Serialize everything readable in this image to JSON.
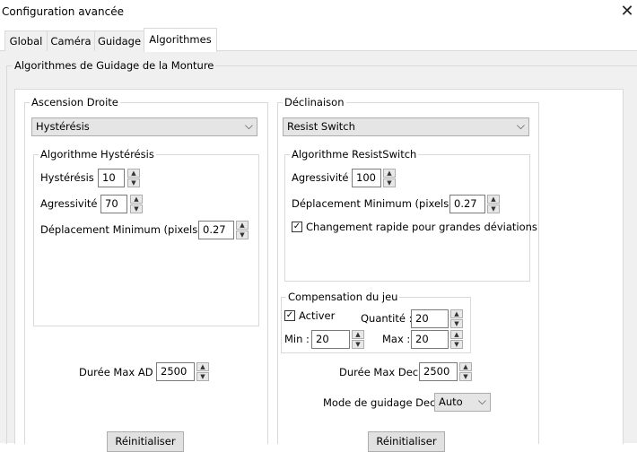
{
  "window": {
    "title": "Configuration avancée"
  },
  "tabs": [
    {
      "label": "Global"
    },
    {
      "label": "Caméra"
    },
    {
      "label": "Guidage"
    },
    {
      "label": "Algorithmes"
    }
  ],
  "section": {
    "title": "Algorithmes de Guidage de la Monture"
  },
  "ra": {
    "title": "Ascension Droite",
    "algorithm_select": "Hystérésis",
    "algo_box_title": "Algorithme Hystérésis",
    "hysteresis_label": "Hystérésis :",
    "hysteresis_value": "10",
    "aggressiveness_label": "Agressivité :",
    "aggressiveness_value": "70",
    "min_move_label": "Déplacement Minimum (pixels) :",
    "min_move_value": "0.27",
    "max_duration_label": "Durée Max AD :",
    "max_duration_value": "2500",
    "reset_button": "Réinitialiser"
  },
  "dec": {
    "title": "Déclinaison",
    "algorithm_select": "Resist Switch",
    "algo_box_title": "Algorithme ResistSwitch",
    "aggressiveness_label": "Agressivité :",
    "aggressiveness_value": "100",
    "min_move_label": "Déplacement Minimum (pixels) :",
    "min_move_value": "0.27",
    "fast_switch_label": "Changement rapide pour grandes déviations",
    "fast_switch_checked": true,
    "backlash_title": "Compensation du jeu",
    "activate_label": "Activer",
    "activate_checked": true,
    "quantity_label": "Quantité :",
    "quantity_value": "20",
    "min_label": "Min :",
    "min_value": "20",
    "max_label": "Max :",
    "max_value": "20",
    "max_duration_label": "Durée Max Dec :",
    "max_duration_value": "2500",
    "guide_mode_label": "Mode de guidage Dec :",
    "guide_mode_value": "Auto",
    "reset_button": "Réinitialiser"
  },
  "icons": {
    "close": "close-icon",
    "chevron": "chevron-down-icon",
    "spin_up": "spin-up-icon",
    "spin_down": "spin-down-icon",
    "check": "check-icon"
  }
}
